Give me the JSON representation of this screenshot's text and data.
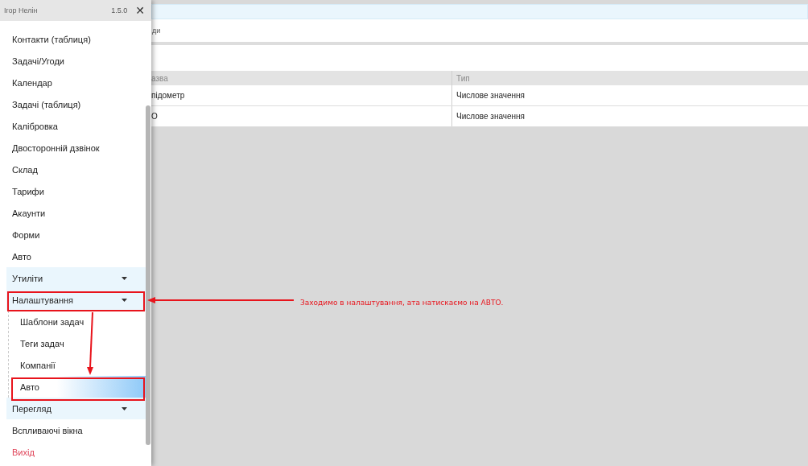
{
  "drawer": {
    "user": "Ігор Нелін",
    "version": "1.5.0",
    "close": "✕",
    "items": [
      {
        "kind": "link",
        "label": "Контакти (таблиця)",
        "selected": false
      },
      {
        "kind": "link",
        "label": "Задачі/Угоди",
        "selected": false
      },
      {
        "kind": "link",
        "label": "Календар",
        "selected": false
      },
      {
        "kind": "link",
        "label": "Задачі (таблиця)",
        "selected": false
      },
      {
        "kind": "link",
        "label": "Калібровка",
        "selected": false
      },
      {
        "kind": "link",
        "label": "Двосторонній дзвінок",
        "selected": false
      },
      {
        "kind": "link",
        "label": "Склад",
        "selected": false
      },
      {
        "kind": "link",
        "label": "Тарифи",
        "selected": false
      },
      {
        "kind": "link",
        "label": "Акаунти",
        "selected": false
      },
      {
        "kind": "link",
        "label": "Форми",
        "selected": false
      },
      {
        "kind": "link",
        "label": "Авто",
        "selected": false
      },
      {
        "kind": "group",
        "label": "Утиліти"
      },
      {
        "kind": "group",
        "label": "Налаштування",
        "children": [
          {
            "label": "Шаблони задач",
            "selected": false
          },
          {
            "label": "Теги задач",
            "selected": false
          },
          {
            "label": "Компанії",
            "selected": false
          },
          {
            "label": "Авто",
            "selected": true
          }
        ]
      },
      {
        "kind": "group",
        "label": "Перегляд"
      },
      {
        "kind": "link",
        "label": "Вспливаючі вікна",
        "selected": false
      },
      {
        "kind": "logout",
        "label": "Вихід",
        "selected": false
      }
    ]
  },
  "content": {
    "breadcrumb": "ди",
    "table": {
      "columns": [
        "азва",
        "Тип"
      ],
      "rows": [
        [
          "підометр",
          "Числове значення"
        ],
        [
          "О",
          "Числове значення"
        ]
      ]
    }
  },
  "annotation": {
    "text": "Заходимо в налаштування, ата натискаємо на АВТО."
  }
}
